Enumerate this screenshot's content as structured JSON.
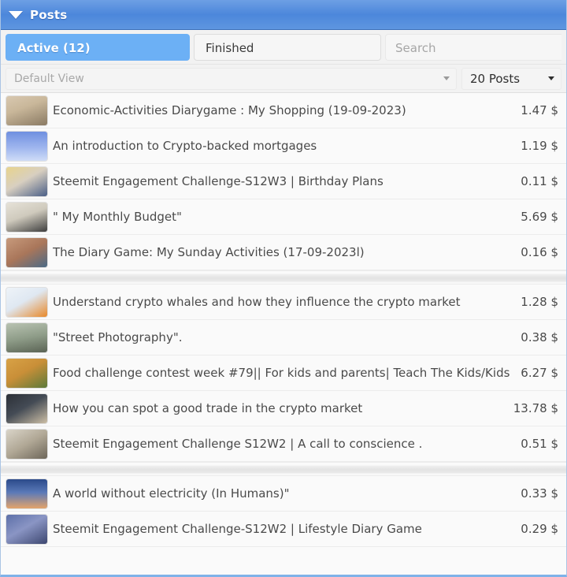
{
  "header": {
    "title": "Posts",
    "collapse_icon": "triangle-down-icon"
  },
  "tabs": [
    {
      "label": "Active (12)",
      "state": "active"
    },
    {
      "label": "Finished",
      "state": "idle"
    }
  ],
  "search": {
    "placeholder": "Search",
    "value": ""
  },
  "filters": {
    "view": {
      "value": "Default View",
      "caret_icon": "caret-down-icon"
    },
    "count": {
      "value": "20 Posts",
      "caret_icon": "caret-down-icon"
    }
  },
  "groups": [
    {
      "rows": [
        {
          "title": "Economic-Activities Diarygame : My Shopping (19-09-2023)",
          "value": "1.47 $",
          "thumb": "man-in-shop-photo"
        },
        {
          "title": "An introduction to Crypto-backed mortgages",
          "value": "1.19 $",
          "thumb": "blue-house-graphic"
        },
        {
          "title": "Steemit Engagement Challenge-S12W3 | Birthday Plans",
          "value": "0.11 $",
          "thumb": "man-in-blue-shirt-photo"
        },
        {
          "title": "\" My Monthly Budget\"",
          "value": "5.69 $",
          "thumb": "calculator-and-money-photo"
        },
        {
          "title": "The Diary Game:  My Sunday Activities (17-09-2023l)",
          "value": "0.16 $",
          "thumb": "man-outdoors-photo"
        }
      ]
    },
    {
      "rows": [
        {
          "title": "Understand crypto whales and how they influence the crypto market",
          "value": "1.28 $",
          "thumb": "whale-bitcoin-illustration"
        },
        {
          "title": "\"Street Photography\".",
          "value": "0.38 $",
          "thumb": "street-scene-photo"
        },
        {
          "title": "Food challenge contest week #79|| For kids and parents| Teach The Kids/Kids",
          "value": "6.27 $",
          "thumb": "man-with-food-photo"
        },
        {
          "title": "How you can spot a good trade in the crypto market",
          "value": "13.78 $",
          "thumb": "trading-screen-photo"
        },
        {
          "title": "Steemit Engagement Challenge S12W2 | A call to conscience .",
          "value": "0.51 $",
          "thumb": "person-indoors-photo"
        }
      ]
    },
    {
      "rows": [
        {
          "title": "A world without electricity (In Humans)\"",
          "value": "0.33 $",
          "thumb": "night-sky-photo"
        },
        {
          "title": "Steemit Engagement Challenge-S12W2 | Lifestyle Diary Game",
          "value": "0.29 $",
          "thumb": "two-people-portrait-photo"
        }
      ]
    }
  ],
  "colors": {
    "header_blue": "#4c87db",
    "tab_active": "#6cb0f5",
    "bottom_border": "#7fb2e8",
    "row_background": "#fafafa",
    "text": "#4a4a4a"
  }
}
